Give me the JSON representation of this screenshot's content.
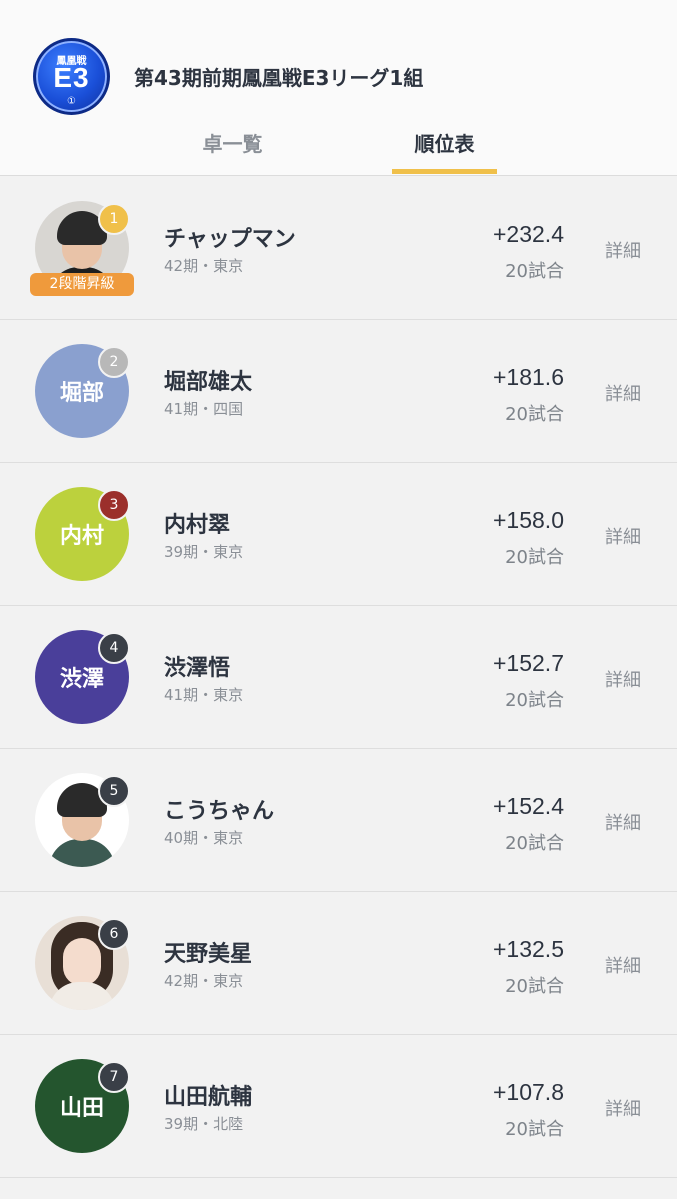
{
  "header": {
    "badge": {
      "top": "鳳凰戦",
      "main": "E3",
      "sub": "①"
    },
    "title": "第43期前期鳳凰戦E3リーグ1組",
    "tabs": [
      {
        "label": "卓一覧",
        "active": false
      },
      {
        "label": "順位表",
        "active": true
      }
    ],
    "accent_color": "#f0c04a"
  },
  "standings": [
    {
      "rank": "1",
      "rank_color": "#f0c04a",
      "avatar_type": "photo",
      "avatar_text": "",
      "avatar_color": "",
      "promo": "2段階昇級",
      "name": "チャップマン",
      "meta": "42期・東京",
      "score": "+232.4",
      "games": "20試合",
      "detail": "詳細"
    },
    {
      "rank": "2",
      "rank_color": "#b8b8b8",
      "avatar_type": "text",
      "avatar_text": "堀部",
      "avatar_color": "#8aa0cf",
      "promo": "",
      "name": "堀部雄太",
      "meta": "41期・四国",
      "score": "+181.6",
      "games": "20試合",
      "detail": "詳細"
    },
    {
      "rank": "3",
      "rank_color": "#9b2f2b",
      "avatar_type": "text",
      "avatar_text": "内村",
      "avatar_color": "#bcd13d",
      "promo": "",
      "name": "内村翠",
      "meta": "39期・東京",
      "score": "+158.0",
      "games": "20試合",
      "detail": "詳細"
    },
    {
      "rank": "4",
      "rank_color": "#3a3f47",
      "avatar_type": "text",
      "avatar_text": "渋澤",
      "avatar_color": "#4a3f9a",
      "promo": "",
      "name": "渋澤悟",
      "meta": "41期・東京",
      "score": "+152.7",
      "games": "20試合",
      "detail": "詳細"
    },
    {
      "rank": "5",
      "rank_color": "#3a3f47",
      "avatar_type": "photo",
      "avatar_text": "",
      "avatar_color": "",
      "promo": "",
      "name": "こうちゃん",
      "meta": "40期・東京",
      "score": "+152.4",
      "games": "20試合",
      "detail": "詳細"
    },
    {
      "rank": "6",
      "rank_color": "#3a3f47",
      "avatar_type": "photo",
      "avatar_text": "",
      "avatar_color": "",
      "promo": "",
      "name": "天野美星",
      "meta": "42期・東京",
      "score": "+132.5",
      "games": "20試合",
      "detail": "詳細"
    },
    {
      "rank": "7",
      "rank_color": "#3a3f47",
      "avatar_type": "text",
      "avatar_text": "山田",
      "avatar_color": "#24552e",
      "promo": "",
      "name": "山田航輔",
      "meta": "39期・北陸",
      "score": "+107.8",
      "games": "20試合",
      "detail": "詳細"
    }
  ]
}
